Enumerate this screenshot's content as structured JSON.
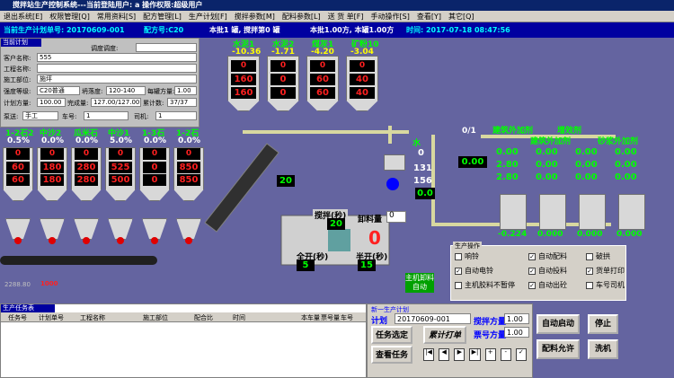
{
  "title": "搅拌站生产控制系统---当前登陆用户: a 操作权限:超级用户",
  "menu": [
    "退出系统[E]",
    "权限管理[Q]",
    "常用资料[S]",
    "配方管理[L]",
    "生产计划[F]",
    "搅拌参数[M]",
    "配料参数[L]",
    "送 货 单[F]",
    "手动操作[S]",
    "查看[Y]",
    "其它[Q]"
  ],
  "info": {
    "plan_no": "当前生产计划单号: 20170609-001",
    "recipe": "配方号:C20",
    "this_batch": "本批1 罐, 搅拌第0 罐",
    "volume": "本批1.00方, 本罐1.00方",
    "time": "时间: 2017-07-18 08:47:56"
  },
  "plan": {
    "header": "当前计划",
    "unit_label": "调度调度:",
    "client_label": "客户名称:",
    "client": "555",
    "project_label": "工程名称:",
    "project": "",
    "part_label": "施工部位:",
    "part": "施坪",
    "grade_label": "强度等级:",
    "grade": "C20普通",
    "slump_label": "坍落度:",
    "slump": "120-140",
    "per_label": "每罐方量:",
    "per": "1.00",
    "planned_label": "计划方量:",
    "planned": "100.00",
    "done_label": "完成量:",
    "done": "127.00/127.00",
    "count_label": "累计数:",
    "count": "37/37",
    "car_label": "车号:",
    "car": "1",
    "driver_label": "司机:",
    "driver": "1",
    "pump_label": "泵送:",
    "pump": "手工"
  },
  "top_silos": [
    {
      "name": "水泥1",
      "delta": "-10.36",
      "v1": "0",
      "v2": "160",
      "v3": "160"
    },
    {
      "name": "水泥2",
      "delta": "-1.71",
      "v1": "0",
      "v2": "0",
      "v3": "0"
    },
    {
      "name": "煤灰1",
      "delta": "-4.20",
      "v1": "0",
      "v2": "60",
      "v3": "60"
    },
    {
      "name": "矿粉10",
      "delta": "-3.04",
      "v1": "0",
      "v2": "40",
      "v3": "40"
    }
  ],
  "aggregates": [
    {
      "name": "1-2石2",
      "pct": "0.5%",
      "v1": "0",
      "v2": "60",
      "v3": "60"
    },
    {
      "name": "中沙2",
      "pct": "0.0%",
      "v1": "0",
      "v2": "180",
      "v3": "180"
    },
    {
      "name": "瓜米石",
      "pct": "0.0%",
      "v1": "0",
      "v2": "280",
      "v3": "280"
    },
    {
      "name": "中沙1",
      "pct": "5.0%",
      "v1": "0",
      "v2": "525",
      "v3": "500"
    },
    {
      "name": "1-3石",
      "pct": "0.0%",
      "v1": "0",
      "v2": "0",
      "v3": "0"
    },
    {
      "name": "1-2石",
      "pct": "0.0%",
      "v1": "0",
      "v2": "850",
      "v3": "850"
    }
  ],
  "water": {
    "name": "水",
    "v1": "0",
    "v2": "131",
    "v3": "156",
    "v4": "0.0"
  },
  "mixer": {
    "stir_label": "搅拌(秒)",
    "stir": "20",
    "disc_label": "卸料量",
    "disc": "0",
    "open_label": "全开(秒)",
    "open": "5",
    "half_label": "半开(秒)",
    "half": "15",
    "count": "0",
    "stir_val2": "20"
  },
  "admix": {
    "h1": "建筑外加剂",
    "h2": "增效剂",
    "h3": "建筑外加剂",
    "h4": "砂浆外加剂",
    "cols": [
      [
        "0.00",
        "2.80",
        "2.80"
      ],
      [
        "0.00",
        "0.00",
        "0.00"
      ],
      [
        "0.00",
        "0.00",
        "0.00"
      ],
      [
        "0.00",
        "0.00",
        "0.00"
      ]
    ],
    "bottoms": [
      "-0.224",
      "0.000",
      "0.000",
      "0.000"
    ],
    "scale": "0.00",
    "frac": "0/1"
  },
  "left_vals": {
    "a": "2288.80",
    "b": "1000"
  },
  "ops": {
    "header": "生产操作",
    "items": [
      "响铃",
      "自动配料",
      "破拱",
      "自动电铃",
      "自动投料",
      "货单打印",
      "主机胶料不暂停",
      "自动出砼",
      "车号司机"
    ]
  },
  "main_btn": "主机卸料自动",
  "task": {
    "header": "生产任务表",
    "cols": [
      "任务号",
      "计划单号",
      "工程名称",
      "施工部位",
      "配合比",
      "时间",
      "本车量",
      "票号量",
      "车号"
    ]
  },
  "plan2": {
    "header": "新一生产计划",
    "plan_label": "计划",
    "plan_no": "20170609-001",
    "stir_label": "搅拌方量",
    "stir": "1.00",
    "ticket_label": "票号方量",
    "ticket": "1.00",
    "task_btn": "任务选定",
    "accum_btn": "累计打单",
    "view_btn": "查看任务"
  },
  "buttons": {
    "auto": "自动启动",
    "stop": "停止",
    "allow": "配料允许",
    "wash": "洗机"
  }
}
